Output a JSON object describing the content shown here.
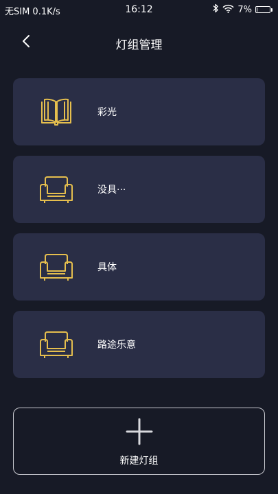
{
  "status_bar": {
    "carrier": "无SIM 0.1K/s",
    "time": "16:12",
    "battery_percent": "7%",
    "battery_level": 0.07,
    "icons": [
      "bluetooth-icon",
      "wifi-icon",
      "battery-icon"
    ]
  },
  "header": {
    "title": "灯组管理",
    "back_icon": "chevron-left-icon"
  },
  "groups": [
    {
      "label": "彩光",
      "icon": "book-icon"
    },
    {
      "label": "没具···",
      "icon": "armchair-icon"
    },
    {
      "label": "具体",
      "icon": "armchair-icon"
    },
    {
      "label": "路途乐意",
      "icon": "armchair-icon"
    }
  ],
  "new_group": {
    "label": "新建灯组",
    "icon": "plus-icon"
  },
  "colors": {
    "background": "#171a26",
    "card": "#2a2e46",
    "icon_accent": "#e6bf4e",
    "text": "#ffffff"
  }
}
